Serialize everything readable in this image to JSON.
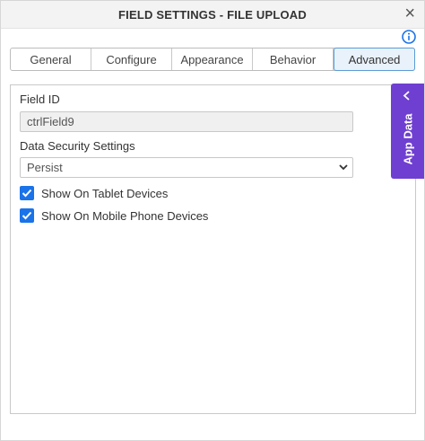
{
  "dialog": {
    "title": "FIELD SETTINGS - FILE UPLOAD",
    "close_glyph": "×",
    "info_icon": "info-icon"
  },
  "tabs": [
    {
      "label": "General",
      "active": false
    },
    {
      "label": "Configure",
      "active": false
    },
    {
      "label": "Appearance",
      "active": false
    },
    {
      "label": "Behavior",
      "active": false
    },
    {
      "label": "Advanced",
      "active": true
    }
  ],
  "form": {
    "field_id_label": "Field ID",
    "field_id_value": "ctrlField9",
    "data_security_label": "Data Security Settings",
    "data_security_value": "Persist",
    "checkboxes": [
      {
        "label": "Show On Tablet Devices",
        "checked": true
      },
      {
        "label": "Show On Mobile Phone Devices",
        "checked": true
      }
    ]
  },
  "side_panel": {
    "label": "App Data"
  },
  "colors": {
    "accent": "#1a73e8",
    "app_data_bg": "#6f3fd1",
    "active_tab_border": "#5b9bd5"
  }
}
